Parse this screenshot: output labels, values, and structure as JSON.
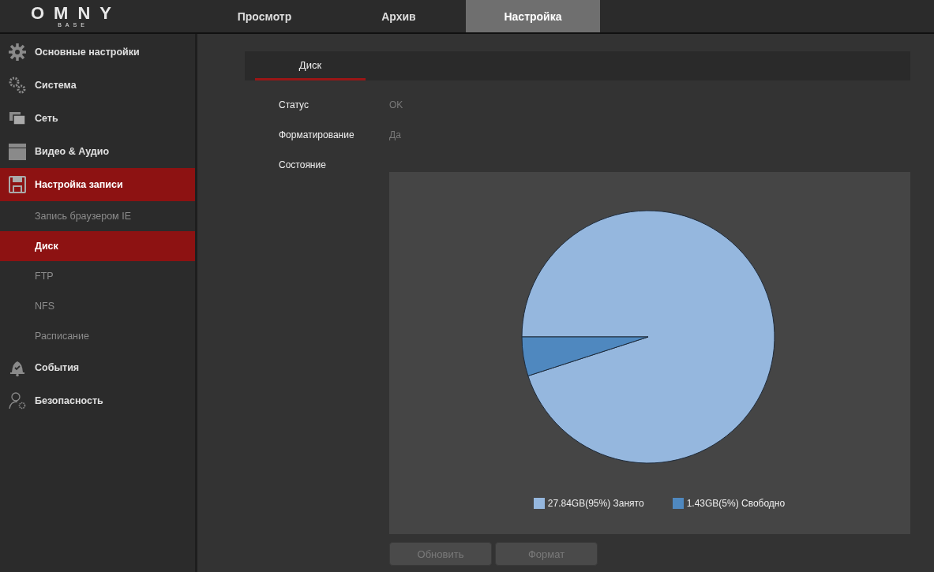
{
  "logo": {
    "name": "OMNY",
    "sub": "BASE"
  },
  "top_tabs": [
    {
      "label": "Просмотр",
      "selected": false
    },
    {
      "label": "Архив",
      "selected": false
    },
    {
      "label": "Настройка",
      "selected": true
    }
  ],
  "sidebar": {
    "items": [
      {
        "kind": "group",
        "label": "Основные настройки",
        "selected": false
      },
      {
        "kind": "group",
        "label": "Система",
        "selected": false
      },
      {
        "kind": "group",
        "label": "Сеть",
        "selected": false
      },
      {
        "kind": "group",
        "label": "Видео & Аудио",
        "selected": false
      },
      {
        "kind": "group",
        "label": "Настройка записи",
        "selected": true,
        "children": [
          {
            "label": "Запись браузером IE",
            "selected": false
          },
          {
            "label": "Диск",
            "selected": true
          },
          {
            "label": "FTP",
            "selected": false
          },
          {
            "label": "NFS",
            "selected": false
          },
          {
            "label": "Расписание",
            "selected": false
          }
        ]
      },
      {
        "kind": "group",
        "label": "События",
        "selected": false
      },
      {
        "kind": "group",
        "label": "Безопасность",
        "selected": false
      }
    ]
  },
  "sub_tabs": [
    {
      "label": "Диск",
      "selected": true
    }
  ],
  "fields": [
    {
      "label": "Статус",
      "value": "OK"
    },
    {
      "label": "Форматирование",
      "value": "Да"
    },
    {
      "label": "Состояние"
    }
  ],
  "chart_data": {
    "type": "pie",
    "categories": [
      "27.84GB(95%) Занято",
      "1.43GB(5%) Свободно"
    ],
    "values": [
      95,
      5
    ]
  },
  "legend": [
    {
      "color": "#95b7de"
    },
    {
      "color": "#4f88bf"
    }
  ],
  "buttons": [
    {
      "label": "Обновить",
      "disabled": true
    },
    {
      "label": "Формат",
      "disabled": true
    }
  ]
}
